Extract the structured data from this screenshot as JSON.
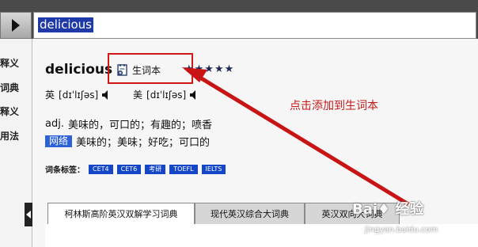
{
  "search": {
    "value": "delicious"
  },
  "sidebar": {
    "items": [
      {
        "label": "释义"
      },
      {
        "label": "词典"
      },
      {
        "label": "释义"
      },
      {
        "label": "用法"
      }
    ]
  },
  "entry": {
    "word": "delicious",
    "add_vocab_label": "生词本",
    "stars": "★★★★★",
    "uk": {
      "label": "英",
      "phonetic": "[dɪˈlɪʃəs]"
    },
    "us": {
      "label": "美",
      "phonetic": "[dɪˈlɪʃəs]"
    },
    "definitions": [
      {
        "pos": "adj.",
        "text": "美味的，可口的；有趣的；喷香"
      }
    ],
    "web": {
      "badge": "网络",
      "text": "美味的；美味；好吃；可口的"
    },
    "tags_label": "词条标签：",
    "tags": [
      "CET4",
      "CET6",
      "考研",
      "TOEFL",
      "IELTS"
    ]
  },
  "annotation": "点击添加到生词本",
  "tabs": [
    {
      "label": "柯林斯高阶英汉双解学习词典"
    },
    {
      "label": "现代英汉综合大词典"
    },
    {
      "label": "英汉双向大词典"
    }
  ],
  "watermark": {
    "brand": "Bai♦ 经验",
    "url": "jingyan.baidu.com"
  },
  "colors": {
    "accent_red": "#d01818",
    "tag_blue": "#1447c8",
    "star_navy": "#1e2a55"
  }
}
